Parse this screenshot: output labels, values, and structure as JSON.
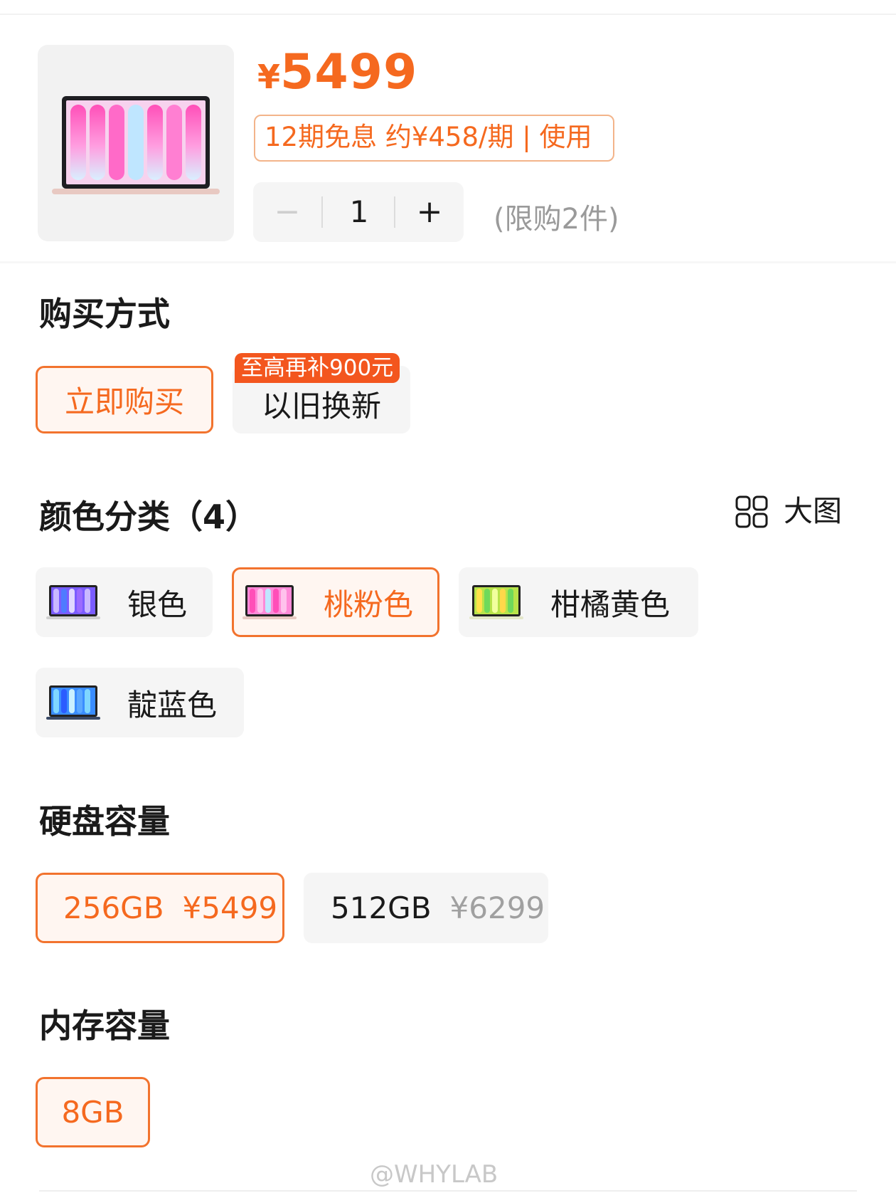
{
  "product": {
    "price_symbol": "¥",
    "price_value": "5499",
    "installment": "12期免息 约¥458/期 | 使用",
    "quantity": "1",
    "quantity_minus": "−",
    "quantity_plus": "+",
    "limit_text": "(限购2件)"
  },
  "purchase": {
    "title": "购买方式",
    "options": [
      {
        "label": "立即购买",
        "selected": true
      },
      {
        "label": "以旧换新",
        "selected": false,
        "badge": "至高再补900元"
      }
    ]
  },
  "color": {
    "title": "颜色分类（4）",
    "view_big_label": "大图",
    "options": [
      {
        "label": "银色",
        "selected": false,
        "icon": "laptop-silver-icon"
      },
      {
        "label": "桃粉色",
        "selected": true,
        "icon": "laptop-pink-icon"
      },
      {
        "label": "柑橘黄色",
        "selected": false,
        "icon": "laptop-yellow-icon"
      },
      {
        "label": "靛蓝色",
        "selected": false,
        "icon": "laptop-indigo-icon"
      }
    ]
  },
  "storage": {
    "title": "硬盘容量",
    "options": [
      {
        "size": "256GB",
        "price": "¥5499",
        "selected": true
      },
      {
        "size": "512GB",
        "price": "¥6299",
        "selected": false
      }
    ]
  },
  "memory": {
    "title": "内存容量",
    "options": [
      {
        "size": "8GB",
        "selected": true
      }
    ]
  },
  "watermark": "@WHYLAB",
  "colors": {
    "accent": "#f5691f",
    "accent_border": "#f2732e",
    "badge": "#f3561e",
    "chip_bg": "#f5f5f5",
    "selected_bg": "#fff6f1"
  }
}
